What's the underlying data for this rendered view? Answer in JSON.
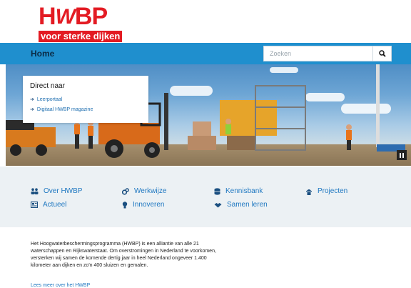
{
  "logo": {
    "text_h": "H",
    "text_w": "W",
    "text_bp": "BP",
    "tagline": "voor sterke dijken"
  },
  "nav": {
    "home": "Home"
  },
  "search": {
    "placeholder": "Zoeken",
    "icon": "search-icon"
  },
  "direct": {
    "title": "Direct naar",
    "links": [
      {
        "label": "Leerportaal"
      },
      {
        "label": "Digitaal HWBP magazine"
      }
    ]
  },
  "quick_links": [
    {
      "label": "Over HWBP",
      "icon": "people-icon"
    },
    {
      "label": "Werkwijze",
      "icon": "gears-icon"
    },
    {
      "label": "Kennisbank",
      "icon": "database-icon"
    },
    {
      "label": "Projecten",
      "icon": "worker-icon"
    },
    {
      "label": "Actueel",
      "icon": "newspaper-icon"
    },
    {
      "label": "Innoveren",
      "icon": "lightbulb-icon"
    },
    {
      "label": "Samen leren",
      "icon": "handshake-icon"
    }
  ],
  "intro": {
    "lines": [
      "Het Hoogwaterbeschermingsprogramma (HWBP) is een alliantie van alle 21",
      "waterschappen en Rijkswaterstaat. Om overstromingen in Nederland te voorkomen,",
      "versterken wij samen de komende dertig jaar in heel Nederland ongeveer 1.400",
      "kilometer aan dijken en zo'n 400 sluizen en gemalen."
    ],
    "read_more": "Lees meer over het HWBP"
  },
  "colors": {
    "brand_red": "#e31b23",
    "nav_blue": "#1f8fce",
    "link_blue": "#1f78c1",
    "band_bg": "#ecf1f4"
  }
}
